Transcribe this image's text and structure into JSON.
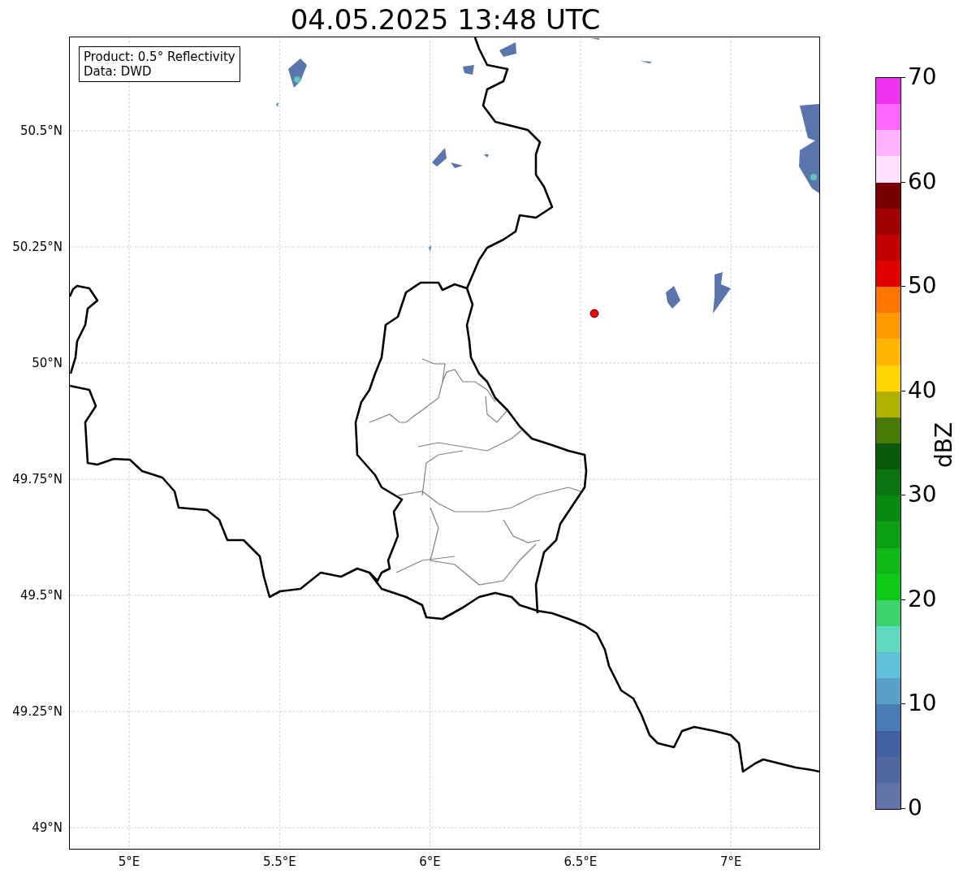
{
  "title": "04.05.2025 13:48 UTC",
  "legend": [
    "Product: 0.5° Reflectivity",
    "Data: DWD"
  ],
  "lat_labels": [
    "50.5°N",
    "50.25°N",
    "50°N",
    "49.75°N",
    "49.5°N",
    "49.25°N",
    "49°N"
  ],
  "lon_labels": [
    "5°E",
    "5.5°E",
    "6°E",
    "6.5°E",
    "7°E"
  ],
  "colorbar": {
    "ticks": [
      "70",
      "60",
      "50",
      "40",
      "30",
      "20",
      "10",
      "0"
    ],
    "bins": [
      {
        "color": "#ee33ee"
      },
      {
        "color": "#ff66ff"
      },
      {
        "color": "#ffb3ff"
      },
      {
        "color": "#ffe0ff"
      },
      {
        "color": "#7a0000"
      },
      {
        "color": "#a00000"
      },
      {
        "color": "#c00000"
      },
      {
        "color": "#e00000"
      },
      {
        "color": "#ff7700"
      },
      {
        "color": "#ff9900"
      },
      {
        "color": "#ffb400"
      },
      {
        "color": "#ffd700"
      },
      {
        "color": "#b0b000"
      },
      {
        "color": "#487a08"
      },
      {
        "color": "#085a08"
      },
      {
        "color": "#0a7510"
      },
      {
        "color": "#0a8a10"
      },
      {
        "color": "#0ea014"
      },
      {
        "color": "#10b818"
      },
      {
        "color": "#10c818"
      },
      {
        "color": "#3cd46e"
      },
      {
        "color": "#60d8c0"
      },
      {
        "color": "#60c0dc"
      },
      {
        "color": "#58a0c8"
      },
      {
        "color": "#4a7cb4"
      },
      {
        "color": "#4060a0"
      },
      {
        "color": "#5068a0"
      },
      {
        "color": "#6474a8"
      }
    ],
    "label": "dBZ"
  }
}
